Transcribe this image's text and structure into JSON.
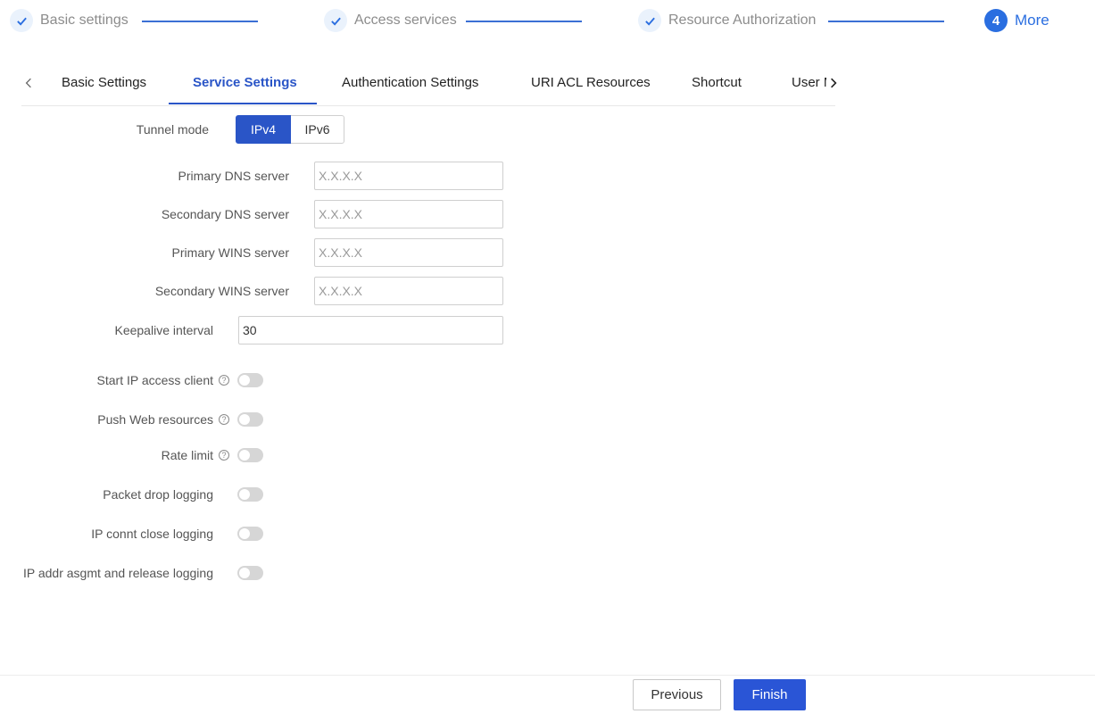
{
  "stepper": {
    "steps": [
      {
        "label": "Basic settings",
        "status": "done"
      },
      {
        "label": "Access services",
        "status": "done"
      },
      {
        "label": "Resource Authorization",
        "status": "done"
      },
      {
        "label": "More",
        "status": "active",
        "number": "4"
      }
    ],
    "accent_color": "#2a6ee0"
  },
  "tabs": {
    "items": [
      {
        "label": "Basic Settings"
      },
      {
        "label": "Service Settings",
        "active": true
      },
      {
        "label": "Authentication Settings"
      },
      {
        "label": "URI ACL Resources"
      },
      {
        "label": "Shortcut"
      },
      {
        "label": "User M"
      }
    ],
    "prev_icon": "chevron-left-icon",
    "next_icon": "chevron-right-icon"
  },
  "form": {
    "tunnel_mode": {
      "label": "Tunnel mode",
      "options": [
        "IPv4",
        "IPv6"
      ],
      "selected": "IPv4"
    },
    "primary_dns": {
      "label": "Primary DNS server",
      "placeholder": "X.X.X.X",
      "value": ""
    },
    "secondary_dns": {
      "label": "Secondary DNS server",
      "placeholder": "X.X.X.X",
      "value": ""
    },
    "primary_wins": {
      "label": "Primary WINS server",
      "placeholder": "X.X.X.X",
      "value": ""
    },
    "secondary_wins": {
      "label": "Secondary WINS server",
      "placeholder": "X.X.X.X",
      "value": ""
    },
    "keepalive": {
      "label": "Keepalive interval",
      "value": "30"
    },
    "toggles": [
      {
        "label": "Start IP access client",
        "help": true,
        "on": false
      },
      {
        "label": "Push Web resources",
        "help": true,
        "on": false
      },
      {
        "label": "Rate limit",
        "help": true,
        "on": false
      },
      {
        "label": "Packet drop logging",
        "help": false,
        "on": false
      },
      {
        "label": "IP connt close logging",
        "help": false,
        "on": false
      },
      {
        "label": "IP addr asgmt and release logging",
        "help": false,
        "on": false
      }
    ],
    "help_glyph": "?"
  },
  "footer": {
    "previous_label": "Previous",
    "finish_label": "Finish",
    "primary_color": "#2a55d6"
  }
}
